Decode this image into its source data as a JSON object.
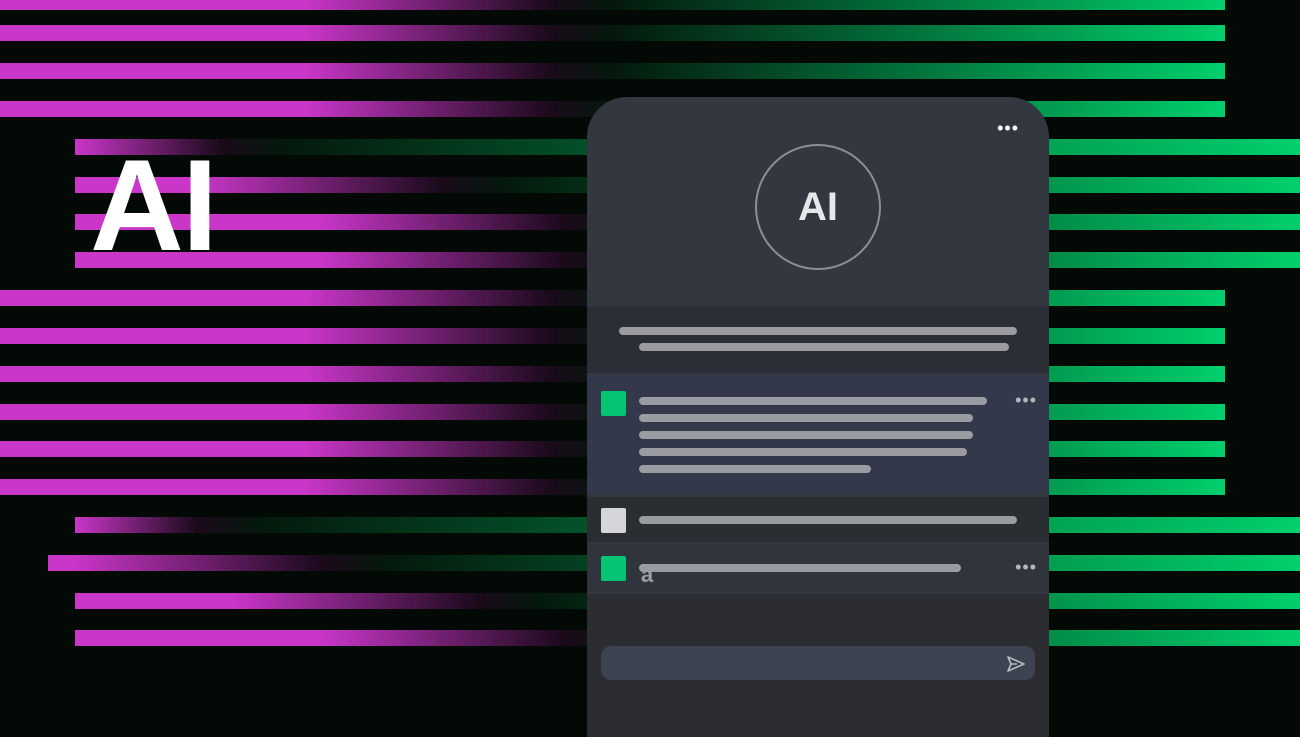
{
  "hero": {
    "title": "AI"
  },
  "chat_panel": {
    "avatar_label": "AI",
    "input": {
      "value": "",
      "placeholder": ""
    }
  },
  "colors": {
    "magenta": "#c936c8",
    "green": "#00cf6c",
    "panel": "#33373f",
    "accent_square": "#05c473"
  },
  "icons": [
    "more-horizontal-icon",
    "send-icon"
  ]
}
